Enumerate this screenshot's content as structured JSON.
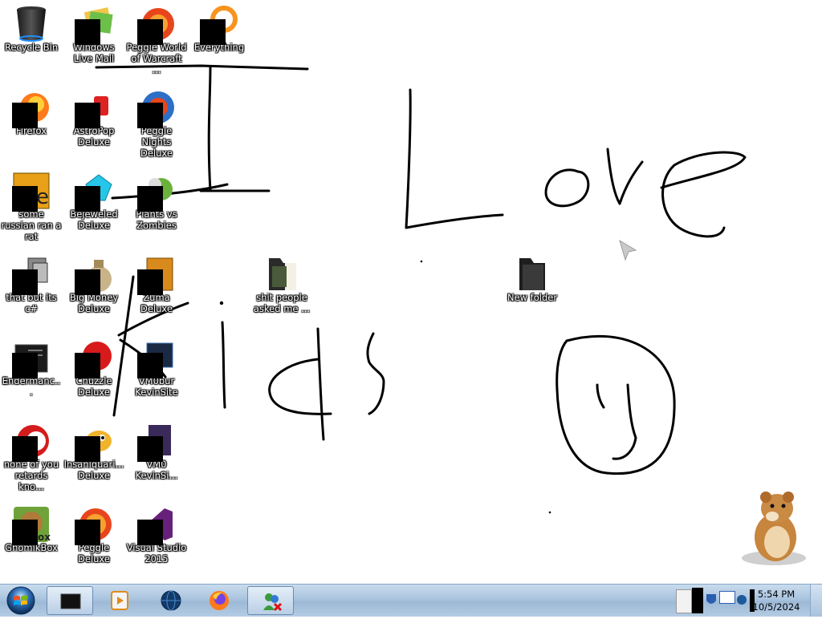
{
  "desktop": {
    "icons": [
      {
        "label": "Recycle Bin",
        "icon": "recycle-bin-icon"
      },
      {
        "label": "Windows Live Mail",
        "icon": "windows-live-mail-icon"
      },
      {
        "label": "Peggle World of Warcraft ...",
        "icon": "peggle-wow-icon"
      },
      {
        "label": "Everything",
        "icon": "everything-search-icon"
      },
      {
        "label": "Firefox",
        "icon": "firefox-icon"
      },
      {
        "label": "AstroPop Deluxe",
        "icon": "astropop-icon"
      },
      {
        "label": "Peggle Nights Deluxe",
        "icon": "peggle-nights-icon"
      },
      {
        "label": "some russian ran a rat",
        "icon": "orange-app-icon"
      },
      {
        "label": "Bejeweled Deluxe",
        "icon": "bejeweled-icon"
      },
      {
        "label": "Plants vs Zombies",
        "icon": "plants-vs-zombies-icon"
      },
      {
        "label": "that but its c#",
        "icon": "window-stack-icon"
      },
      {
        "label": "Big Money Deluxe",
        "icon": "money-bag-icon"
      },
      {
        "label": "Zuma Deluxe",
        "icon": "zuma-icon"
      },
      {
        "label": "shit people asked me ...",
        "icon": "folder-icon"
      },
      {
        "label": "New folder",
        "icon": "folder-icon"
      },
      {
        "label": "Endermanc...",
        "icon": "dark-window-icon"
      },
      {
        "label": "Chuzzle Deluxe",
        "icon": "chuzzle-icon"
      },
      {
        "label": "VM0bur KevinSite",
        "icon": "vm-icon"
      },
      {
        "label": "none of you retards kno...",
        "icon": "red-ball-icon"
      },
      {
        "label": "Insaniquari... Deluxe",
        "icon": "fish-icon"
      },
      {
        "label": "VM0 KevinSi...",
        "icon": "vm-file-icon"
      },
      {
        "label": "GhomikBox",
        "icon": "hamster-box-icon"
      },
      {
        "label": "Peggle Deluxe",
        "icon": "peggle-icon"
      },
      {
        "label": "Visual Studio 2015",
        "icon": "visual-studio-icon"
      }
    ]
  },
  "taskbar": {
    "start_label": "Start",
    "pinned": [
      {
        "name": "black-window-app",
        "active": true
      },
      {
        "name": "media-player",
        "active": false
      },
      {
        "name": "globe-app",
        "active": false
      },
      {
        "name": "firefox",
        "active": false
      },
      {
        "name": "messenger-app",
        "active": true
      }
    ],
    "clock": {
      "time": "5:54 PM",
      "date": "10/5/2024"
    }
  },
  "colors": {
    "taskbar": "#aac4df",
    "ink": "#000000"
  }
}
